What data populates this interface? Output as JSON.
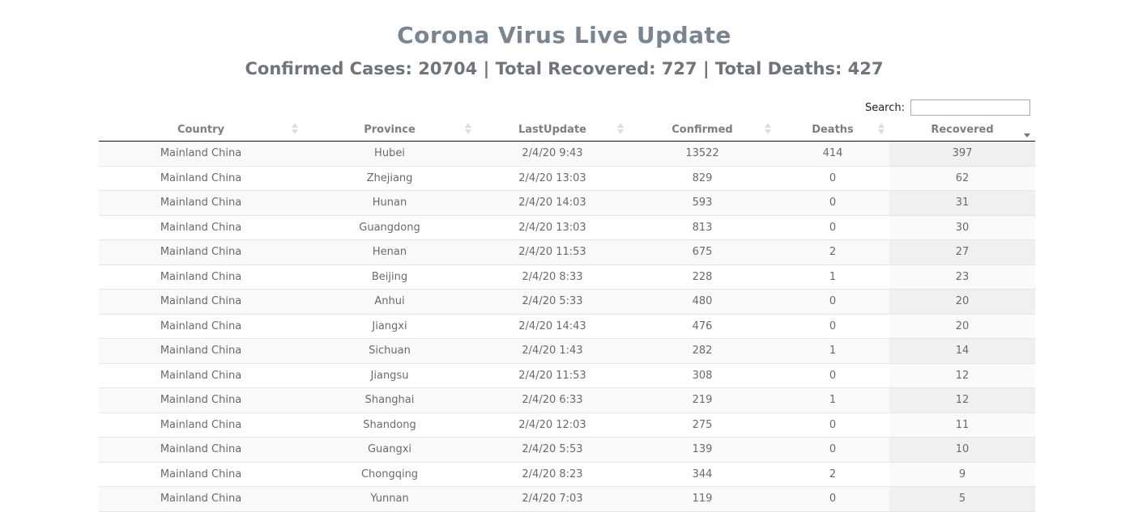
{
  "page": {
    "title": "Corona Virus Live Update",
    "summary": "Confirmed Cases: 20704 | Total Recovered: 727 | Total Deaths: 427"
  },
  "search": {
    "label": "Search:",
    "value": "",
    "placeholder": ""
  },
  "table": {
    "columns": [
      "Country",
      "Province",
      "LastUpdate",
      "Confirmed",
      "Deaths",
      "Recovered"
    ],
    "sorted_column": "Recovered",
    "sort_direction": "descending",
    "rows": [
      [
        "Mainland China",
        "Hubei",
        "2/4/20 9:43",
        "13522",
        "414",
        "397"
      ],
      [
        "Mainland China",
        "Zhejiang",
        "2/4/20 13:03",
        "829",
        "0",
        "62"
      ],
      [
        "Mainland China",
        "Hunan",
        "2/4/20 14:03",
        "593",
        "0",
        "31"
      ],
      [
        "Mainland China",
        "Guangdong",
        "2/4/20 13:03",
        "813",
        "0",
        "30"
      ],
      [
        "Mainland China",
        "Henan",
        "2/4/20 11:53",
        "675",
        "2",
        "27"
      ],
      [
        "Mainland China",
        "Beijing",
        "2/4/20 8:33",
        "228",
        "1",
        "23"
      ],
      [
        "Mainland China",
        "Anhui",
        "2/4/20 5:33",
        "480",
        "0",
        "20"
      ],
      [
        "Mainland China",
        "Jiangxi",
        "2/4/20 14:43",
        "476",
        "0",
        "20"
      ],
      [
        "Mainland China",
        "Sichuan",
        "2/4/20 1:43",
        "282",
        "1",
        "14"
      ],
      [
        "Mainland China",
        "Jiangsu",
        "2/4/20 11:53",
        "308",
        "0",
        "12"
      ],
      [
        "Mainland China",
        "Shanghai",
        "2/4/20 6:33",
        "219",
        "1",
        "12"
      ],
      [
        "Mainland China",
        "Shandong",
        "2/4/20 12:03",
        "275",
        "0",
        "11"
      ],
      [
        "Mainland China",
        "Guangxi",
        "2/4/20 5:53",
        "139",
        "0",
        "10"
      ],
      [
        "Mainland China",
        "Chongqing",
        "2/4/20 8:23",
        "344",
        "2",
        "9"
      ],
      [
        "Mainland China",
        "Yunnan",
        "2/4/20 7:03",
        "119",
        "0",
        "5"
      ]
    ]
  },
  "icons": {
    "sort_both": "sort-both-icon",
    "sort_desc": "sort-desc-icon"
  },
  "colors": {
    "title": "#7a8590",
    "header_border": "#111111",
    "odd_row": "#f9f9f9",
    "sorted_col": "#f0f0f0"
  }
}
